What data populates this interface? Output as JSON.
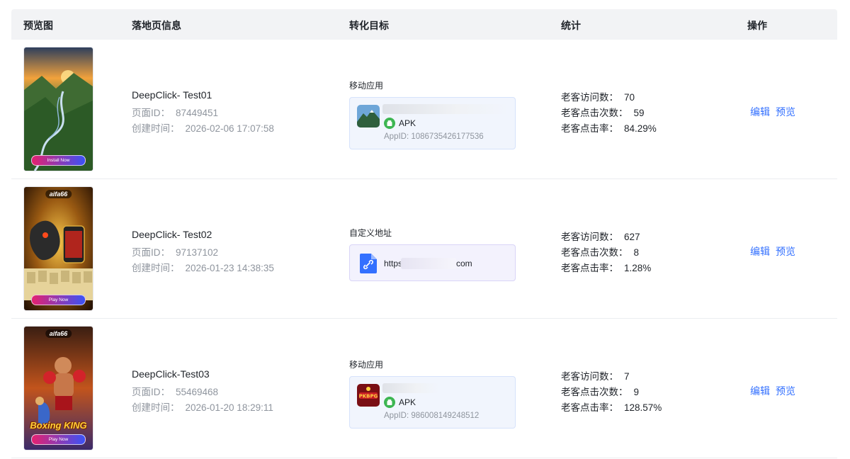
{
  "header": {
    "col_preview": "预览图",
    "col_info": "落地页信息",
    "col_goal": "转化目标",
    "col_stats": "统计",
    "col_ops": "操作"
  },
  "labels": {
    "page_id": "页面ID：",
    "created": "创建时间：",
    "visits": "老客访问数：",
    "clicks": "老客点击次数：",
    "ctr": "老客点击率：",
    "edit": "编辑",
    "preview": "预览",
    "apk": "APK",
    "appid_prefix": "AppID: "
  },
  "rows": [
    {
      "thumb": {
        "brand": "",
        "cta": "Install Now",
        "overlay_title": ""
      },
      "name": "DeepClick- Test01",
      "page_id": "87449451",
      "created": "2026-02-06 17:07:58",
      "goal_type": "移动应用",
      "app_id": "AppID: 1086735426177536",
      "visits": "70",
      "clicks": "59",
      "ctr": "84.29%"
    },
    {
      "thumb": {
        "brand": "aifa66",
        "cta": "Play Now",
        "overlay_title": ""
      },
      "name": "DeepClick- Test02",
      "page_id": "97137102",
      "created": "2026-01-23 14:38:35",
      "goal_type": "自定义地址",
      "url_start": "https:",
      "url_end": "com",
      "visits": "627",
      "clicks": "8",
      "ctr": "1.28%"
    },
    {
      "thumb": {
        "brand": "aifa66",
        "cta": "Play Now",
        "overlay_title": "Boxing KING"
      },
      "name": "DeepClick-Test03",
      "page_id": "55469468",
      "created": "2026-01-20 18:29:11",
      "goal_type": "移动应用",
      "app_id": "AppID: 986008149248512",
      "visits": "7",
      "clicks": "9",
      "ctr": "128.57%"
    }
  ],
  "colors": {
    "header_bg": "#f2f3f5",
    "link": "#3370ff",
    "muted": "#8f959e",
    "app_card_bg": "#f1f5fd",
    "url_card_bg": "#f3f2fd",
    "android_green": "#3db652"
  },
  "icons": [
    "android-icon",
    "link-file-icon",
    "app-icon-mountain",
    "app-icon-pkbpg"
  ]
}
